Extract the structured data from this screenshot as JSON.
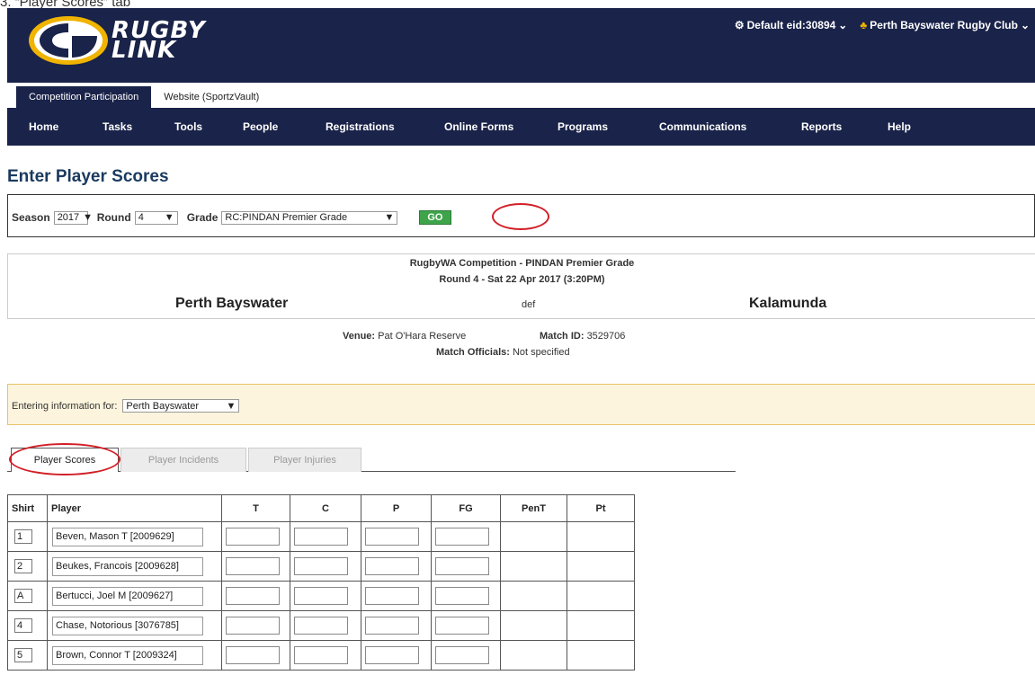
{
  "caption": "3. “Player Scores” tab",
  "header": {
    "logo_line1": "RUGBY",
    "logo_line2": "LINK",
    "entity_label": "Default eid:30894",
    "club_label": "Perth Bayswater Rugby Club"
  },
  "subtabs": [
    {
      "label": "Competition Participation",
      "active": true
    },
    {
      "label": "Website (SportzVault)",
      "active": false
    }
  ],
  "nav": [
    "Home",
    "Tasks",
    "Tools",
    "People",
    "Registrations",
    "Online Forms",
    "Programs",
    "Communications",
    "Reports",
    "Help"
  ],
  "page_title": "Enter Player Scores",
  "filters": {
    "season_label": "Season",
    "season_value": "2017",
    "round_label": "Round",
    "round_value": "4",
    "grade_label": "Grade",
    "grade_value": "RC:PINDAN Premier Grade",
    "go_label": "GO"
  },
  "match": {
    "competition": "RugbyWA Competition - PINDAN Premier Grade",
    "round_info": "Round 4 - Sat 22 Apr 2017 (3:20PM)",
    "home_team": "Perth Bayswater",
    "result": "def",
    "away_team": "Kalamunda",
    "venue_label": "Venue:",
    "venue_value": "Pat O'Hara Reserve",
    "match_id_label": "Match ID:",
    "match_id_value": "3529706",
    "officials_label": "Match Officials:",
    "officials_value": "Not specified"
  },
  "entering": {
    "label": "Entering information for:",
    "value": "Perth Bayswater"
  },
  "tabs": [
    {
      "label": "Player Scores",
      "active": true
    },
    {
      "label": "Player Incidents",
      "active": false
    },
    {
      "label": "Player Injuries",
      "active": false
    }
  ],
  "table": {
    "columns": [
      "Shirt",
      "Player",
      "T",
      "C",
      "P",
      "FG",
      "PenT",
      "Pt"
    ],
    "rows": [
      {
        "shirt": "1",
        "player": "Beven, Mason T [2009629]"
      },
      {
        "shirt": "2",
        "player": "Beukes, Francois [2009628]"
      },
      {
        "shirt": "A",
        "player": "Bertucci, Joel M [2009627]"
      },
      {
        "shirt": "4",
        "player": "Chase, Notorious [3076785]"
      },
      {
        "shirt": "5",
        "player": "Brown, Connor T [2009324]"
      }
    ]
  },
  "colors": {
    "navy": "#1a2349",
    "go_green": "#3da44a",
    "highlight_red": "#d21f26",
    "notice_bg": "#fcf4dc"
  }
}
